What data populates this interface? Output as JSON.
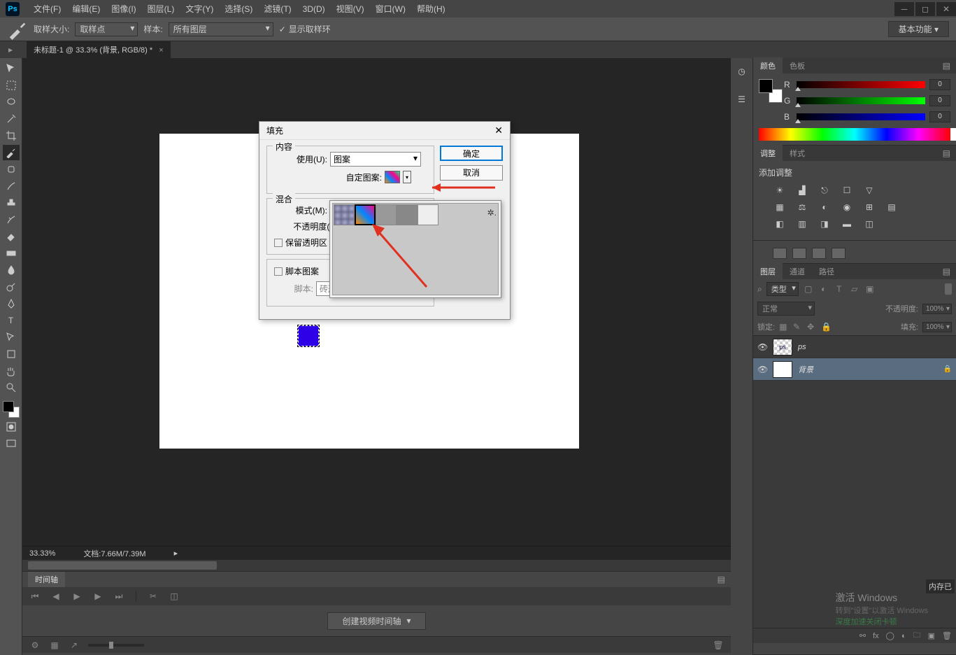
{
  "app_logo": "Ps",
  "menu": [
    "文件(F)",
    "编辑(E)",
    "图像(I)",
    "图层(L)",
    "文字(Y)",
    "选择(S)",
    "滤镜(T)",
    "3D(D)",
    "视图(V)",
    "窗口(W)",
    "帮助(H)"
  ],
  "options_bar": {
    "sample_size_label": "取样大小:",
    "sample_size_value": "取样点",
    "sample_label": "样本:",
    "sample_value": "所有图层",
    "show_ring": "显示取样环"
  },
  "workspace": "基本功能",
  "document_tab": "未标题-1 @ 33.3% (背景, RGB/8) *",
  "status_zoom": "33.33%",
  "status_doc": "文档:7.66M/7.39M",
  "timeline": {
    "tab": "时间轴",
    "create_btn": "创建视频时间轴"
  },
  "panels": {
    "color": {
      "tabs": [
        "颜色",
        "色板"
      ],
      "r": "0",
      "g": "0",
      "b": "0"
    },
    "adjust": {
      "tabs": [
        "调整",
        "样式"
      ],
      "label": "添加调整"
    },
    "layers": {
      "tabs": [
        "图层",
        "通道",
        "路径"
      ],
      "filter": "类型",
      "blend": "正常",
      "opacity_label": "不透明度:",
      "opacity_value": "100%",
      "lock_label": "锁定:",
      "fill_label": "填充:",
      "fill_value": "100%",
      "items": [
        {
          "name": "ps",
          "locked": false
        },
        {
          "name": "背景",
          "locked": true
        }
      ]
    }
  },
  "dialog": {
    "title": "填充",
    "content_legend": "内容",
    "use_label": "使用(U):",
    "use_value": "图案",
    "custom_pattern_label": "自定图案:",
    "blend_legend": "混合",
    "mode_label": "模式(M):",
    "opacity_label": "不透明度(O):",
    "preserve_trans": "保留透明区",
    "script_pattern": "脚本图案",
    "script_label": "脚本:",
    "script_value": "砖形填充",
    "ok": "确定",
    "cancel": "取消"
  },
  "watermark": {
    "line1": "激活 Windows",
    "line2": "转到\"设置\"以激活 Windows",
    "line3": "深度加速关闭卡顿"
  },
  "mem_label": "内存已"
}
